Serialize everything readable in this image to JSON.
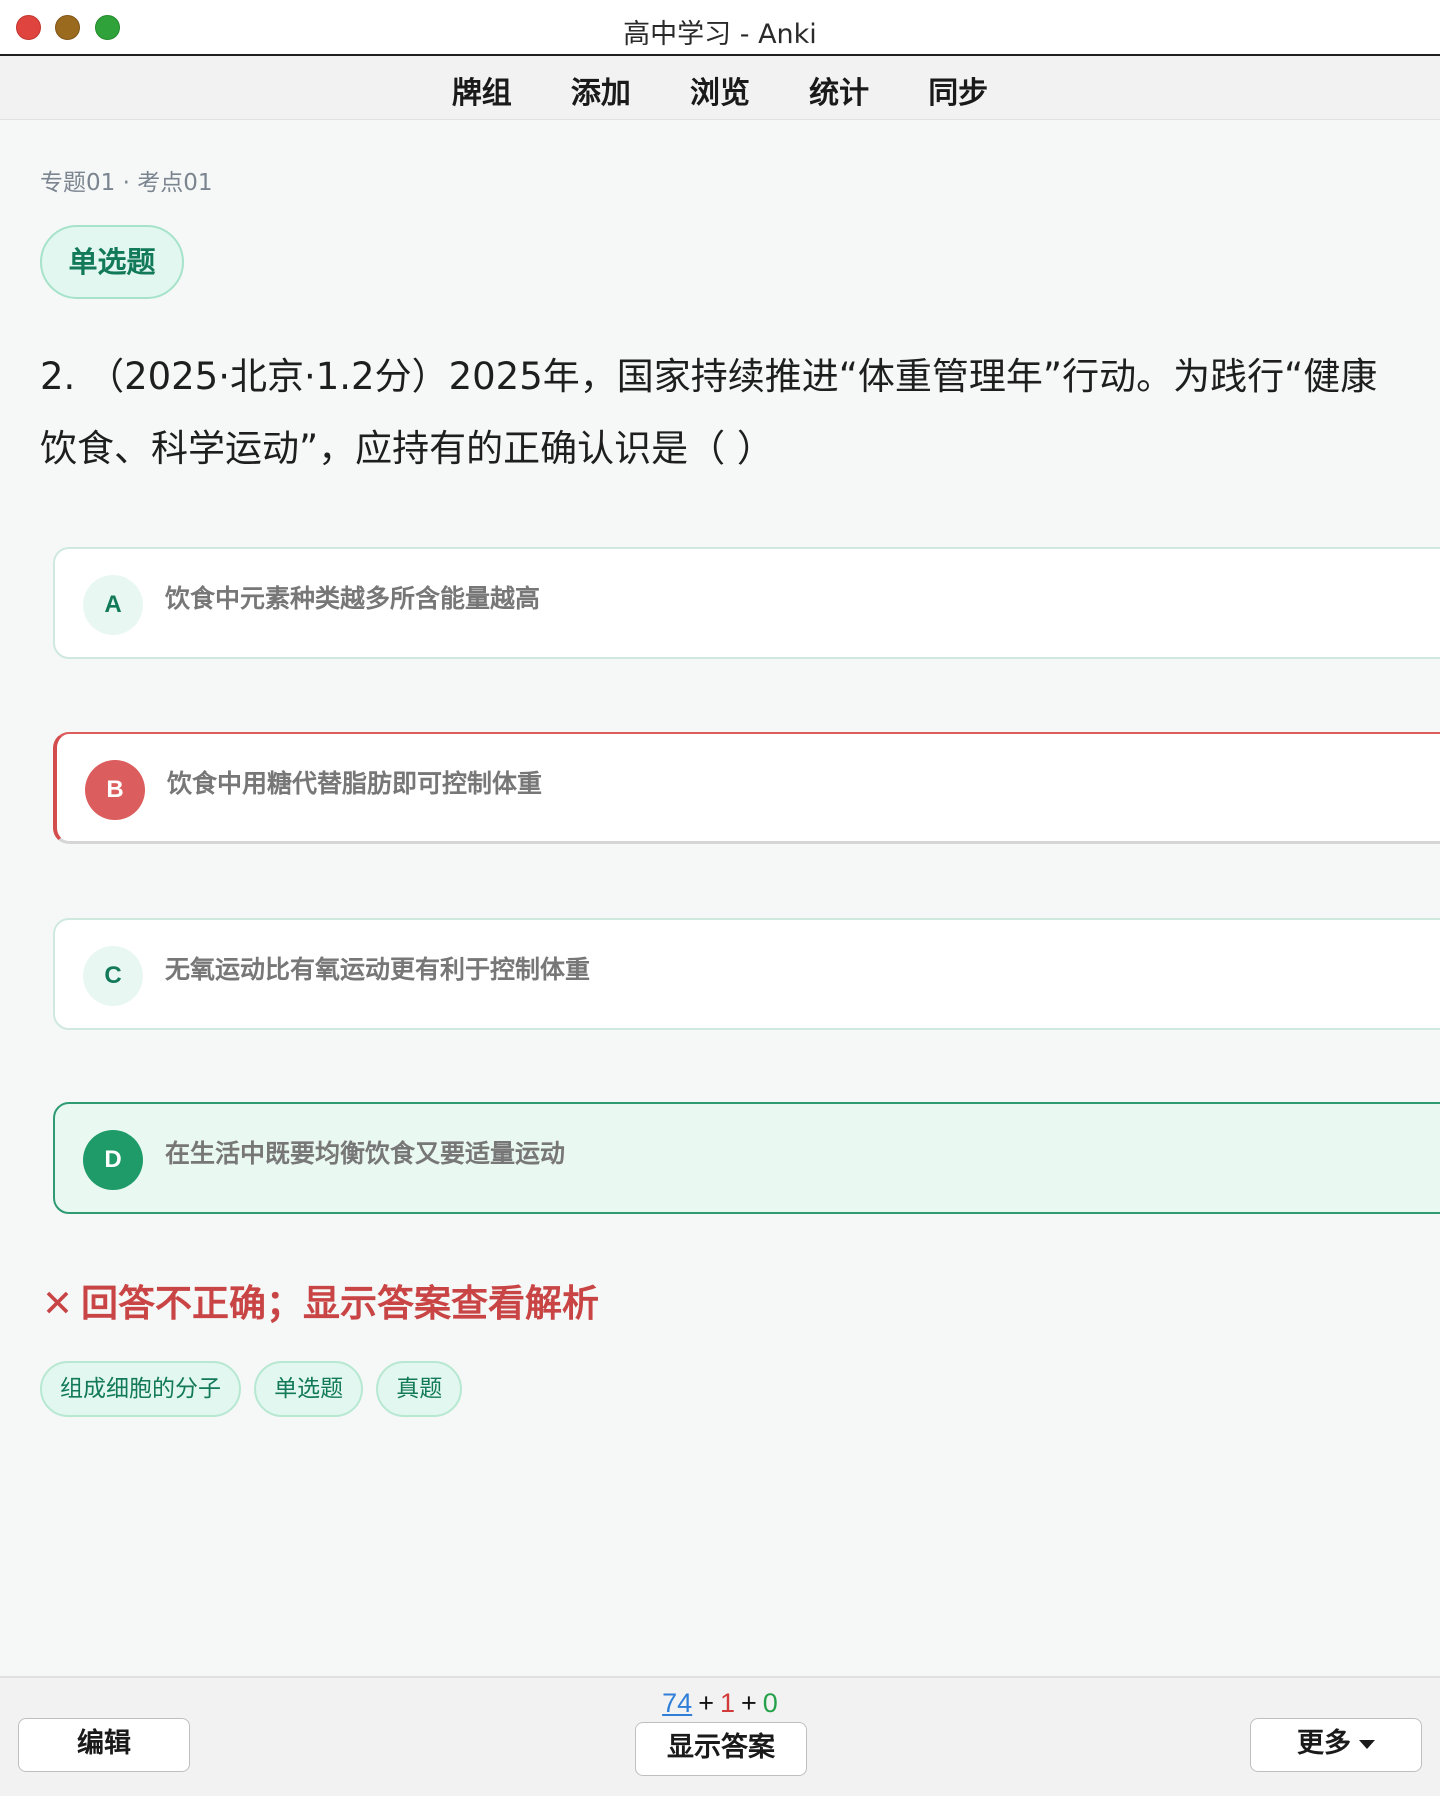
{
  "window": {
    "title": "高中学习 - Anki"
  },
  "nav": {
    "items": [
      "牌组",
      "添加",
      "浏览",
      "统计",
      "同步"
    ]
  },
  "card": {
    "breadcrumb": "专题01 · 考点01",
    "type_badge": "单选题",
    "question": "2. （2025·北京·1.2分）2025年，国家持续推进“体重管理年”行动。为践行“健康饮食、科学运动”，应持有的正确认识是（ ）",
    "options": [
      {
        "letter": "A",
        "text": "饮食中元素种类越多所含能量越高",
        "state": "neutral"
      },
      {
        "letter": "B",
        "text": "饮食中用糖代替脂肪即可控制体重",
        "state": "selected-wrong"
      },
      {
        "letter": "C",
        "text": "无氧运动比有氧运动更有利于控制体重",
        "state": "neutral"
      },
      {
        "letter": "D",
        "text": "在生活中既要均衡饮食又要适量运动",
        "state": "correct"
      }
    ],
    "result_icon": "✕",
    "result_text": "回答不正确；显示答案查看解析",
    "tags": [
      "组成细胞的分子",
      "单选题",
      "真题"
    ]
  },
  "bottom": {
    "counts": {
      "new": "74",
      "learn": "1",
      "review": "0",
      "plus": "+"
    },
    "edit_label": "编辑",
    "show_answer_label": "显示答案",
    "more_label": "更多"
  },
  "colors": {
    "accent": "#137a59",
    "wrong": "#c94444",
    "correct": "#1f9b69"
  }
}
